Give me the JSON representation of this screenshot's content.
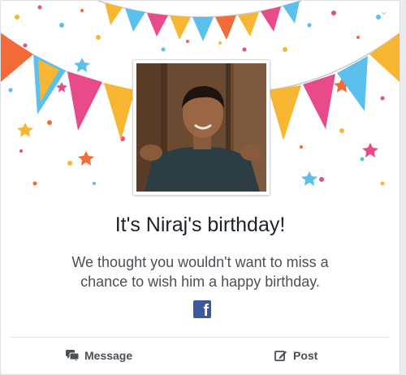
{
  "card": {
    "title": "It's Niraj's birthday!",
    "subtitle": "We thought you wouldn't want to miss a chance to wish him a happy birthday.",
    "logo_icon": "facebook-logo-icon",
    "menu_icon": "chevron-down-icon",
    "colors": {
      "brand": "#3b5998",
      "title_text": "#1d2129",
      "body_text": "#4b4f56"
    }
  },
  "actions": {
    "message_label": "Message",
    "message_icon": "message-bubbles-icon",
    "post_label": "Post",
    "post_icon": "pencil-edit-icon"
  }
}
